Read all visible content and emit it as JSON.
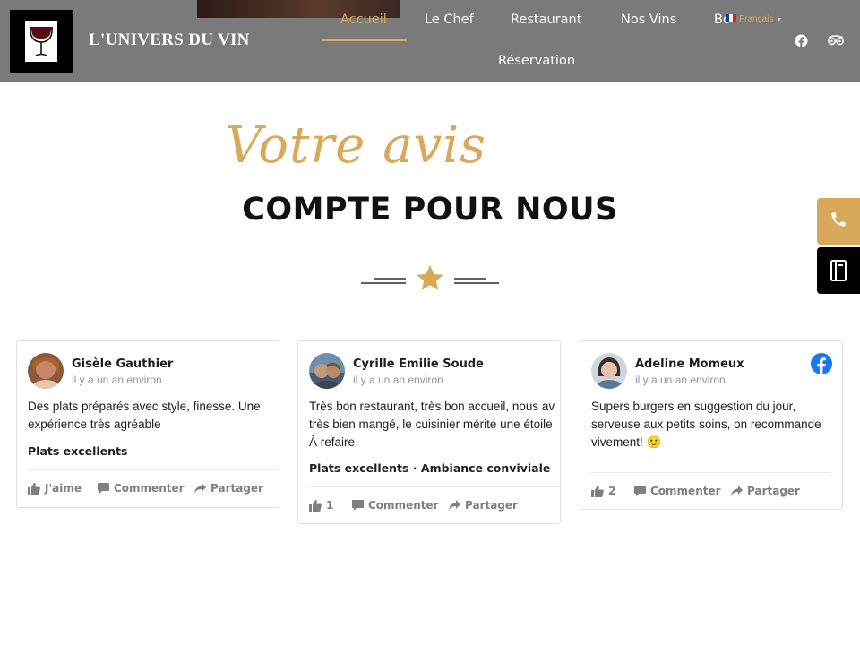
{
  "header": {
    "brand": "L'UNIVERS DU VIN",
    "nav": [
      {
        "label": "Accueil",
        "active": true
      },
      {
        "label": "Le Chef"
      },
      {
        "label": "Restaurant"
      },
      {
        "label": "Nos Vins"
      },
      {
        "label": "Bo"
      },
      {
        "label": "Réservation"
      }
    ],
    "language": "Français",
    "social_icons": [
      "facebook-icon",
      "tripadvisor-icon"
    ]
  },
  "hero": {
    "script_title": "Votre avis",
    "title": "COMPTE POUR NOUS"
  },
  "side_buttons": [
    "phone-icon",
    "book-icon"
  ],
  "reviews": [
    {
      "name": "Gisèle Gauthier",
      "time": "il y a un an environ",
      "text_lines": [
        "Des plats préparés avec style, finesse. Une",
        "expérience très agréable"
      ],
      "tags": "Plats excellents",
      "like_label": "J'aime",
      "comment_label": "Commenter",
      "share_label": "Partager"
    },
    {
      "name": "Cyrille Emilie Soude",
      "time": "il y a un an environ",
      "text_lines": [
        "Très bon restaurant, très bon accueil, nous av",
        "très bien mangé, le cuisinier mérite une étoile",
        "À refaire"
      ],
      "tags": "Plats excellents · Ambiance conviviale",
      "like_label": "1",
      "comment_label": "Commenter",
      "share_label": "Partager"
    },
    {
      "name": "Adeline Momeux",
      "time": "il y a un an environ",
      "text_lines": [
        "Supers burgers en suggestion du jour,",
        "serveuse aux petits soins, on recommande",
        "vivement! 🙂"
      ],
      "like_label": "2",
      "comment_label": "Commenter",
      "share_label": "Partager"
    }
  ],
  "colors": {
    "header_bg": "#7a7a7a",
    "accent_gold": "#d9a95a",
    "facebook_blue": "#1877f2"
  }
}
